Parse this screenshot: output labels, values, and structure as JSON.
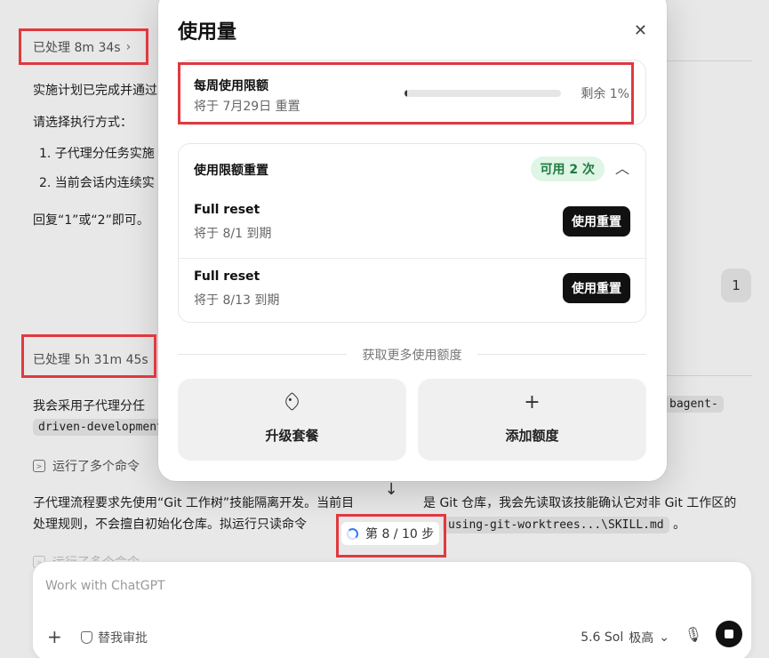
{
  "chat": {
    "processed_1": "已处理 8m 34s",
    "processed_2": "已处理 5h 31m 45s",
    "line_plan": "实施计划已完成并通过",
    "line_choose": "请选择执行方式：",
    "option_1": "1. 子代理分任务实施",
    "option_2": "2. 当前会话内连续实",
    "line_reply": "回复“1”或“2”即可。",
    "user_reply": "1",
    "line_adopt": "我会采用子代理分任",
    "code_1": "bagent-",
    "code_2": "driven-development",
    "ran_commands": "运行了多个命令",
    "para_1": "子代理流程要求先使用“Git 工作树”技能隔离开发。当前目",
    "para_1_mid": "是 Git 仓库，我会先读取该技能确认它对非 Git 工作区的",
    "para_2": "处理规则，不会擅自初始化仓库。拟运行只读命令",
    "code_3": "using-git-worktrees...\\SKILL.md",
    "para_2_end": "。",
    "ran_commands_faded": "运行了多个命令"
  },
  "step": {
    "label": "第 8 / 10 步"
  },
  "composer": {
    "placeholder": "Work with ChatGPT",
    "approve_label": "替我审批",
    "model_label": "5.6 Sol",
    "effort_label": "极高"
  },
  "modal": {
    "title": "使用量",
    "weekly": {
      "title": "每周使用限额",
      "reset_text": "将于 7月29日 重置",
      "remaining_label": "剩余 1%",
      "remaining_fraction": 0.01
    },
    "resets": {
      "title": "使用限额重置",
      "available_badge": "可用 2 次",
      "items": [
        {
          "name": "Full reset",
          "expiry": "将于 8/1 到期",
          "button": "使用重置"
        },
        {
          "name": "Full reset",
          "expiry": "将于 8/13 到期",
          "button": "使用重置"
        }
      ]
    },
    "more_label": "获取更多使用额度",
    "upgrade_label": "升级套餐",
    "add_credit_label": "添加额度"
  },
  "colors": {
    "highlight_box": "#e0393f",
    "badge_bg": "#dff5e6",
    "badge_text": "#1f7a3f",
    "button_bg": "#111111",
    "spinner": "#2f7df6"
  }
}
